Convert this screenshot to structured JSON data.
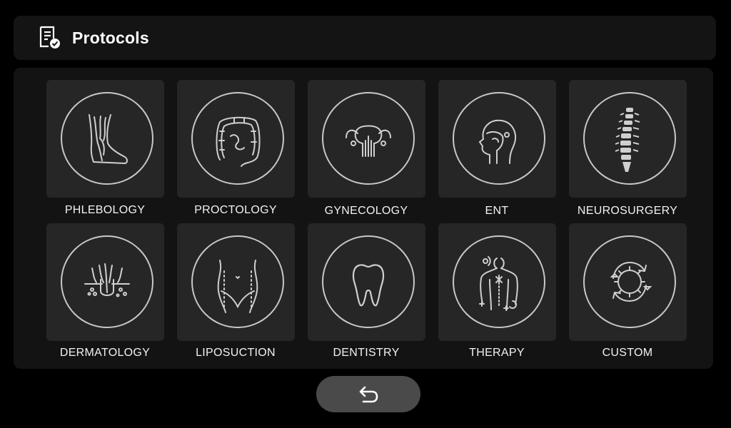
{
  "header": {
    "title": "Protocols",
    "icon": "protocol-list-icon"
  },
  "protocols": [
    {
      "label": "PHLEBOLOGY",
      "icon": "leg-veins-icon"
    },
    {
      "label": "PROCTOLOGY",
      "icon": "intestine-icon"
    },
    {
      "label": "GYNECOLOGY",
      "icon": "uterus-icon"
    },
    {
      "label": "ENT",
      "icon": "head-throat-icon"
    },
    {
      "label": "NEUROSURGERY",
      "icon": "spine-icon"
    },
    {
      "label": "DERMATOLOGY",
      "icon": "hair-follicle-icon"
    },
    {
      "label": "LIPOSUCTION",
      "icon": "abdomen-icon"
    },
    {
      "label": "DENTISTRY",
      "icon": "tooth-icon"
    },
    {
      "label": "THERAPY",
      "icon": "body-back-icon"
    },
    {
      "label": "CUSTOM",
      "icon": "custom-cycle-icon"
    }
  ],
  "back_button": {
    "icon": "back-arrow-icon"
  },
  "colors": {
    "background": "#000000",
    "panel": "#131313",
    "tile": "#262626",
    "stroke": "#c8c8c8",
    "button": "#4a4a4a"
  }
}
